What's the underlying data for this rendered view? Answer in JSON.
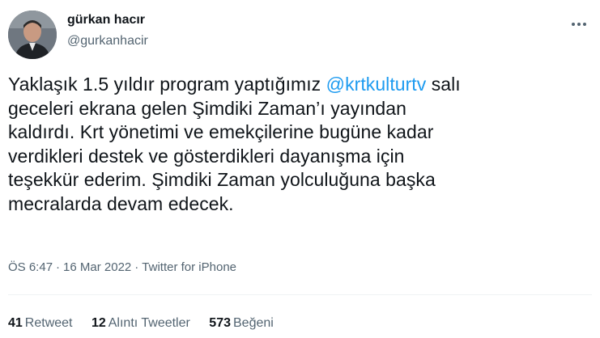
{
  "author": {
    "name": "gürkan hacır",
    "handle": "@gurkanhacir"
  },
  "tweet": {
    "lines": [
      {
        "before": "Yaklaşık 1.5 yıldır program yaptığımız ",
        "mention": "@krtkulturtv",
        "after": " salı"
      },
      {
        "text": "geceleri ekrana gelen Şimdiki Zaman’ı yayından"
      },
      {
        "text": "kaldırdı. Krt yönetimi ve emekçilerine bugüne kadar"
      },
      {
        "text": "verdikleri destek ve gösterdikleri dayanışma için"
      },
      {
        "text": "teşekkür ederim. Şimdiki Zaman yolculuğuna başka"
      },
      {
        "text": "mecralarda devam edecek."
      }
    ]
  },
  "meta": {
    "time": "ÖS 6:47",
    "separator": "·",
    "date": "16 Mar 2022",
    "source": "Twitter for iPhone"
  },
  "stats": {
    "retweets": {
      "count": "41",
      "label": "Retweet"
    },
    "quotes": {
      "count": "12",
      "label": "Alıntı Tweetler"
    },
    "likes": {
      "count": "573",
      "label": "Beğeni"
    }
  },
  "colors": {
    "text": "#0f1419",
    "secondary": "#536471",
    "mention": "#1d9bf0",
    "divider": "#eff3f4"
  },
  "icons": {
    "more": "more-horizontal-icon"
  }
}
